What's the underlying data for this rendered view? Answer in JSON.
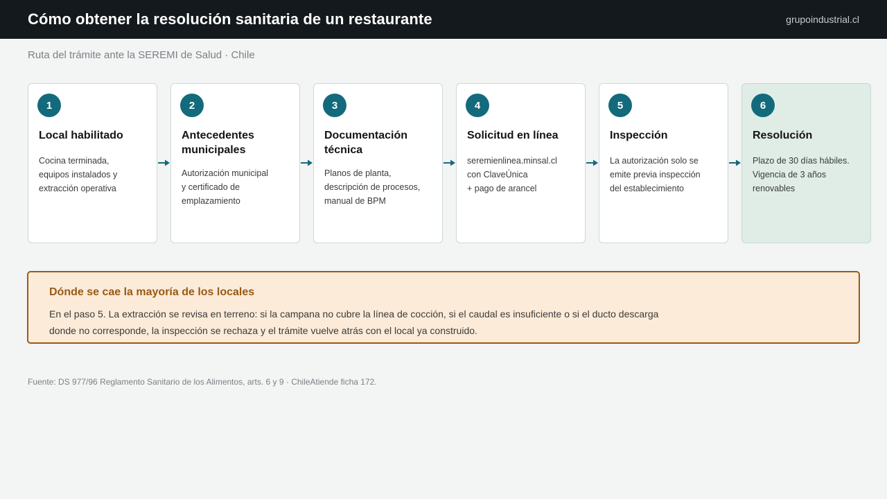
{
  "header": {
    "title": "Cómo obtener la resolución sanitaria de un restaurante",
    "brand": "grupoindustrial.cl"
  },
  "subtitle": "Ruta del trámite ante la SEREMI de Salud · Chile",
  "steps": [
    {
      "number": "1",
      "title": "Local habilitado",
      "description": "Cocina terminada,\nequipos instalados y\nextracción operativa"
    },
    {
      "number": "2",
      "title": "Antecedentes municipales",
      "description": "Autorización municipal\ny certificado de\nemplazamiento"
    },
    {
      "number": "3",
      "title": "Documentación técnica",
      "description": "Planos de planta,\ndescripción de procesos,\nmanual de BPM"
    },
    {
      "number": "4",
      "title": "Solicitud en línea",
      "description": "seremienlinea.minsal.cl\ncon ClaveÚnica\n+ pago de arancel"
    },
    {
      "number": "5",
      "title": "Inspección",
      "description": "La autorización solo se\nemite previa inspección\ndel establecimiento"
    },
    {
      "number": "6",
      "title": "Resolución",
      "description": "Plazo de 30 días hábiles.\nVigencia de 3 años\nrenovables"
    }
  ],
  "callout": {
    "title": "Dónde se cae la mayoría de los locales",
    "text": "En el paso 5. La extracción se revisa en terreno: si la campana no cubre la línea de cocción, si el caudal es insuficiente o si el ducto descarga donde no corresponde, la inspección se rechaza y el trámite vuelve atrás con el local ya construido."
  },
  "footer": "Fuente: DS 977/96 Reglamento Sanitario de los Alimentos, arts. 6 y 9 · ChileAtiende ficha 172.",
  "colors": {
    "header_bg": "#13191c",
    "accent": "#136a7c",
    "final_step_bg": "#dfede6",
    "callout_bg": "#fcebd9",
    "callout_accent": "#9b5a13"
  }
}
